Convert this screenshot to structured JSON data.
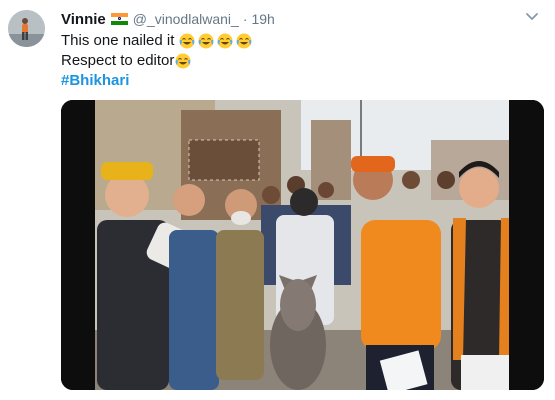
{
  "tweet": {
    "display_name": "Vinnie",
    "handle": "@_vinodlalwani_",
    "separator": "·",
    "time": "19h",
    "lines": [
      "This one nailed it",
      "Respect to editor"
    ],
    "hashtag": "#Bhikhari"
  },
  "icons": {
    "flag": "india-flag-icon",
    "emoji": "face-with-tears-of-joy-emoji",
    "caret": "chevron-down-icon"
  },
  "colors": {
    "name": "#14171a",
    "secondary_text": "#657786",
    "hashtag": "#1b95e0",
    "flag_saffron": "#ff9933",
    "flag_green": "#138808"
  }
}
